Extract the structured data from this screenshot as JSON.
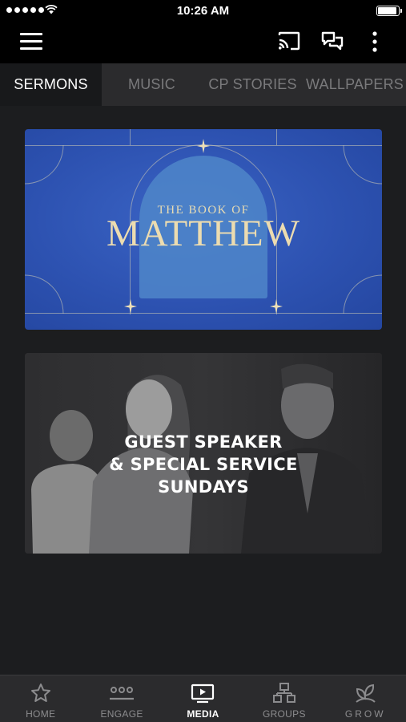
{
  "status_bar": {
    "time": "10:26 AM",
    "battery_level": 0.9
  },
  "header": {
    "menu_icon": "hamburger-menu-icon",
    "cast_icon": "cast-icon",
    "chat_icon": "chat-icon",
    "more_icon": "more-vertical-icon"
  },
  "tabs": [
    {
      "label": "SERMONS",
      "active": true
    },
    {
      "label": "MUSIC",
      "active": false
    },
    {
      "label": "CP STORIES",
      "active": false
    },
    {
      "label": "WALLPAPERS",
      "active": false
    }
  ],
  "cards": {
    "matthew": {
      "line1": "THE BOOK OF",
      "line2": "MATTHEW"
    },
    "guest": {
      "line1": "GUEST SPEAKER",
      "line2": "& SPECIAL SERVICE",
      "line3": "SUNDAYS"
    }
  },
  "bottom_nav": [
    {
      "label": "HOME",
      "icon": "star-icon",
      "active": false
    },
    {
      "label": "ENGAGE",
      "icon": "people-icon",
      "active": false
    },
    {
      "label": "MEDIA",
      "icon": "tv-play-icon",
      "active": true
    },
    {
      "label": "GROUPS",
      "icon": "groups-icon",
      "active": false
    },
    {
      "label": "GROW",
      "icon": "sprout-icon",
      "active": false
    }
  ],
  "colors": {
    "background": "#1c1d1f",
    "header": "#000000",
    "tab_bar": "#2b2b2d",
    "card_blue": "#2d52b1",
    "title_gold": "#ecdcb0"
  }
}
